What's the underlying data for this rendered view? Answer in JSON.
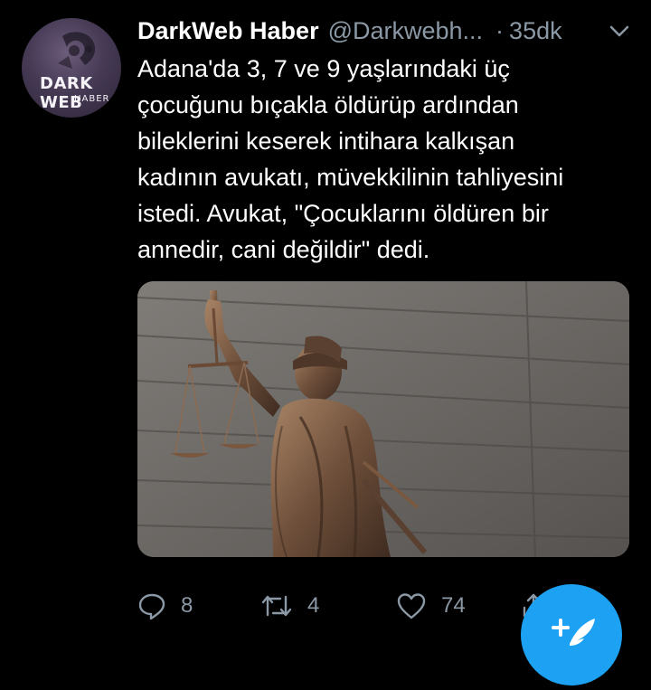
{
  "tweet": {
    "author": {
      "name": "DarkWeb Haber",
      "handle": "@Darkwebh...",
      "avatar": {
        "logo_top": "DARK WEB",
        "logo_bottom": "HABER"
      }
    },
    "separator": "·",
    "time": "35dk",
    "text_lines": [
      "Adana'da 3, 7 ve 9 yaşlarındaki üç",
      "çocuğunu bıçakla öldürüp ardından",
      "bileklerini keserek intihara kalkışan",
      "kadının avukatı, müvekkilinin tahliyesini",
      "istedi. Avukat, \"Çocuklarını öldüren bir",
      "annedir, cani değildir\" dedi."
    ],
    "media": {
      "subject": "lady-justice-statue-photo"
    },
    "actions": {
      "replies": {
        "icon": "reply-icon",
        "count": "8"
      },
      "retweets": {
        "icon": "retweet-icon",
        "count": "4"
      },
      "likes": {
        "icon": "like-icon",
        "count": "74"
      },
      "share": {
        "icon": "share-icon"
      }
    }
  },
  "compose_fab": {
    "icon": "compose-tweet-icon",
    "color": "#1da1f2"
  },
  "colors": {
    "background": "#000000",
    "text": "#ffffff",
    "muted": "#8b98a5",
    "accent": "#1da1f2"
  }
}
